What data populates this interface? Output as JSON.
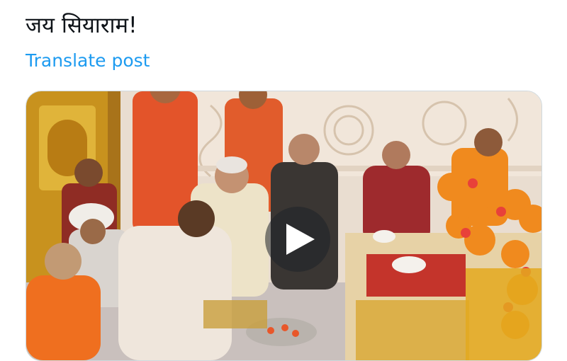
{
  "post": {
    "text": "जय सियाराम!",
    "translate_label": "Translate post"
  },
  "media": {
    "type": "video",
    "play_icon": "play-icon",
    "colors": {
      "saffron": "#e8572a",
      "gold": "#d9a21c",
      "marigold": "#f08a1e",
      "marble": "#efe3d6"
    }
  }
}
